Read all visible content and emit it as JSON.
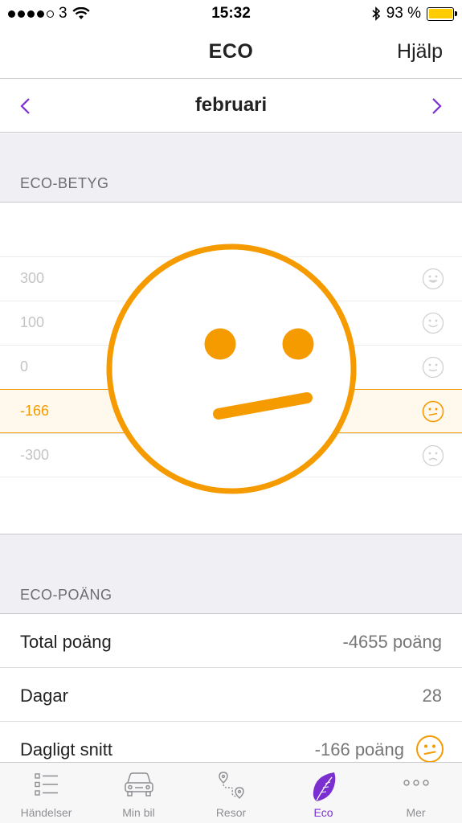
{
  "status_bar": {
    "carrier": "3",
    "time": "15:32",
    "battery": "93 %"
  },
  "nav": {
    "title": "ECO",
    "help": "Hjälp"
  },
  "month": {
    "name": "februari"
  },
  "eco_betyg": {
    "header": "ECO-BETYG",
    "rows": [
      {
        "value": "300",
        "face": "happy-face-icon"
      },
      {
        "value": "100",
        "face": "smile-face-icon"
      },
      {
        "value": "0",
        "face": "slight-smile-face-icon"
      },
      {
        "value": "-166",
        "face": "neutral-face-icon",
        "active": true
      },
      {
        "value": "-300",
        "face": "sad-face-icon"
      }
    ]
  },
  "eco_poang": {
    "header": "ECO-POÄNG",
    "rows": [
      {
        "label": "Total poäng",
        "value": "-4655 poäng"
      },
      {
        "label": "Dagar",
        "value": "28"
      },
      {
        "label": "Dagligt snitt",
        "value": "-166 poäng"
      }
    ]
  },
  "tabs": [
    {
      "label": "Händelser",
      "icon": "list-icon"
    },
    {
      "label": "Min bil",
      "icon": "car-icon"
    },
    {
      "label": "Resor",
      "icon": "route-icon"
    },
    {
      "label": "Eco",
      "icon": "leaf-icon",
      "active": true
    },
    {
      "label": "Mer",
      "icon": "more-icon"
    }
  ],
  "colors": {
    "accent": "#7b2fd1",
    "eco_orange": "#f59b00"
  }
}
